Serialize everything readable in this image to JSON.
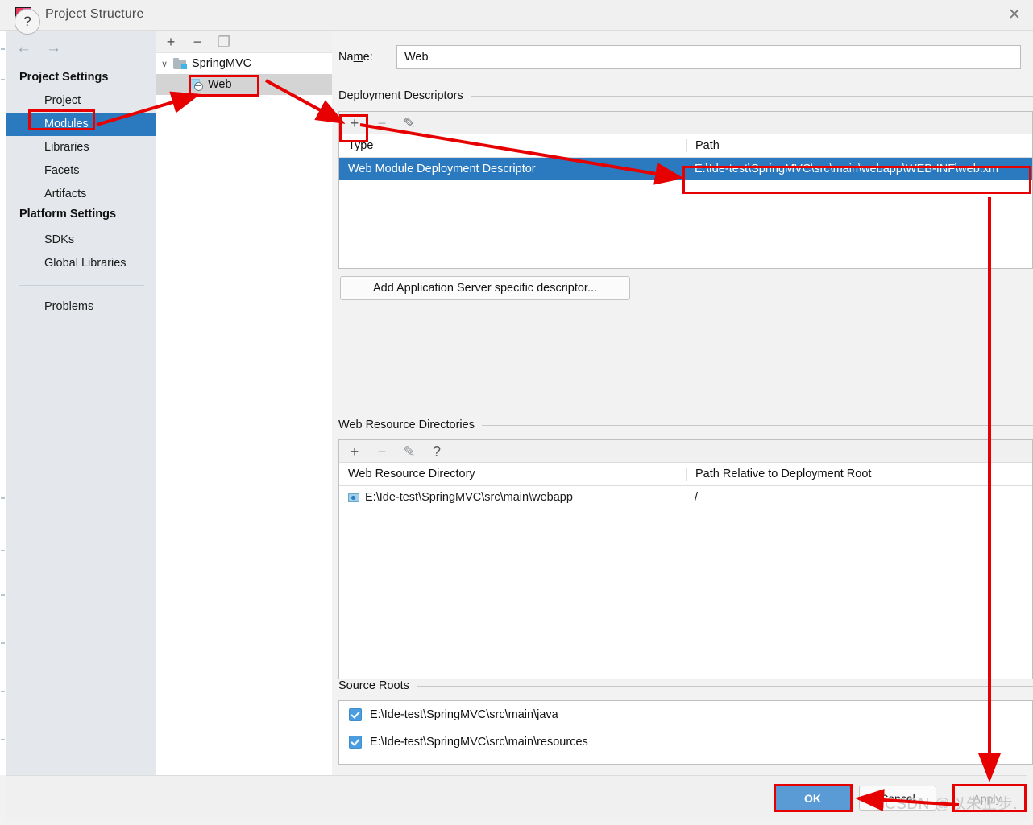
{
  "window": {
    "title": "Project Structure",
    "app_icon": "intellij-idea-icon",
    "close_label": "✕"
  },
  "sidebar": {
    "back_icon": "←",
    "forward_icon": "→",
    "groups": [
      {
        "label": "Project Settings"
      },
      {
        "label": "Platform Settings"
      }
    ],
    "items": [
      {
        "label": "Project",
        "selected": false
      },
      {
        "label": "Modules",
        "selected": true
      },
      {
        "label": "Libraries",
        "selected": false
      },
      {
        "label": "Facets",
        "selected": false
      },
      {
        "label": "Artifacts",
        "selected": false
      },
      {
        "label": "SDKs",
        "selected": false
      },
      {
        "label": "Global Libraries",
        "selected": false
      },
      {
        "label": "Problems",
        "selected": false
      }
    ]
  },
  "tree": {
    "toolbar": [
      {
        "name": "add-icon",
        "glyph": "+"
      },
      {
        "name": "remove-icon",
        "glyph": "−"
      },
      {
        "name": "copy-icon",
        "glyph": "❐"
      }
    ],
    "nodes": [
      {
        "label": "SpringMVC",
        "icon": "module-folder-icon",
        "expanded": true,
        "selected": false
      },
      {
        "label": "Web",
        "icon": "web-facet-icon",
        "expanded": false,
        "selected": true
      }
    ],
    "chevron_expanded": "∨"
  },
  "main": {
    "name_label_pre": "Na",
    "name_label_mnemonic": "m",
    "name_label_post": "e:",
    "name_value": "Web",
    "name_placeholder": "",
    "deployment": {
      "title": "Deployment Descriptors",
      "toolbar": [
        {
          "name": "add-icon",
          "glyph": "+",
          "enabled": true
        },
        {
          "name": "remove-icon",
          "glyph": "−",
          "enabled": false
        },
        {
          "name": "edit-pencil-icon",
          "glyph": "✎",
          "enabled": false
        }
      ],
      "columns": [
        "Type",
        "Path"
      ],
      "rows": [
        {
          "type": "Web Module Deployment Descriptor",
          "path": "E:\\Ide-test\\SpringMVC\\src\\main\\webapp\\WEB-INF\\web.xm",
          "selected": true
        }
      ],
      "add_server_descriptor_button": "Add Application Server specific descriptor..."
    },
    "web_resources": {
      "title": "Web Resource Directories",
      "toolbar": [
        {
          "name": "add-icon",
          "glyph": "+",
          "enabled": true
        },
        {
          "name": "remove-icon",
          "glyph": "−",
          "enabled": false
        },
        {
          "name": "edit-pencil-icon",
          "glyph": "✎",
          "enabled": false
        },
        {
          "name": "help-icon",
          "glyph": "?",
          "enabled": true
        }
      ],
      "columns": [
        "Web Resource Directory",
        "Path Relative to Deployment Root"
      ],
      "rows": [
        {
          "directory": "E:\\Ide-test\\SpringMVC\\src\\main\\webapp",
          "relative_path": "/"
        }
      ]
    },
    "source_roots": {
      "title": "Source Roots",
      "items": [
        {
          "label": "E:\\Ide-test\\SpringMVC\\src\\main\\java",
          "checked": true
        },
        {
          "label": "E:\\Ide-test\\SpringMVC\\src\\main\\resources",
          "checked": true
        }
      ]
    }
  },
  "footer": {
    "help_glyph": "?",
    "ok_label": "OK",
    "cancel_label": "Cancel",
    "apply_label": "Apply"
  },
  "watermark": "CSDN @以朱正步.",
  "colors": {
    "accent": "#2b7ac0",
    "annotation": "#e60000",
    "ok_button": "#5a9bd5",
    "sidebar_bg": "#e4e8ec"
  }
}
